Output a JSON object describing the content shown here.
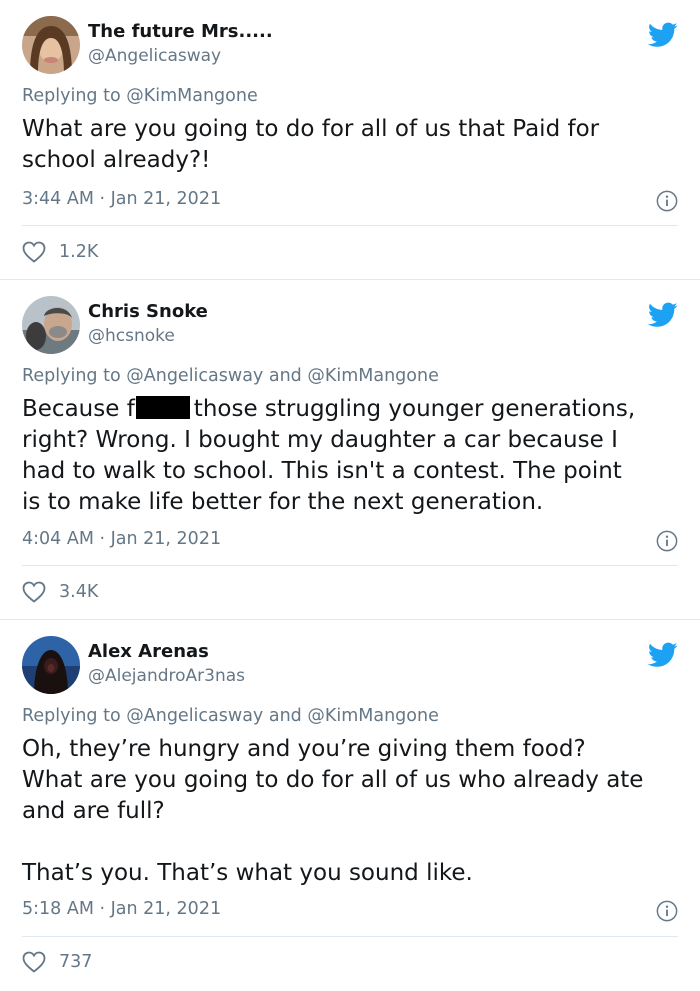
{
  "tweets": [
    {
      "display_name": "The future Mrs.....",
      "handle": "@Angelicasway",
      "replying_prefix": "Replying to",
      "replying_to": [
        "@KimMangone"
      ],
      "text_lines": [
        "What are you going to do for all of us that Paid for",
        "school already?!"
      ],
      "timestamp": "3:44 AM · Jan 21, 2021",
      "likes": "1.2K",
      "avatar_icon": "avatar-photo-woman",
      "brand_icon": "twitter-bird-icon"
    },
    {
      "display_name": "Chris Snoke",
      "handle": "@hcsnoke",
      "replying_prefix": "Replying to",
      "replying_to": [
        "@Angelicasway",
        "@KimMangone"
      ],
      "replying_joiner": "and",
      "text_first_part": "Because f",
      "text_first_rest": "those struggling younger generations,",
      "text_lines": [
        "right? Wrong. I bought my daughter a car because I",
        "had to walk to school. This isn't a contest. The point",
        "is to make life better for the next generation."
      ],
      "timestamp": "4:04 AM · Jan 21, 2021",
      "likes": "3.4K",
      "avatar_icon": "avatar-photo-man",
      "brand_icon": "twitter-bird-icon"
    },
    {
      "display_name": "Alex Arenas",
      "handle": "@AlejandroAr3nas",
      "replying_prefix": "Replying to",
      "replying_to": [
        "@Angelicasway",
        "@KimMangone"
      ],
      "replying_joiner": "and",
      "paragraph_1": [
        "Oh, they’re hungry and you’re giving them food?",
        "What are you going to do for all of us who already ate",
        "and are full?"
      ],
      "paragraph_2": [
        "That’s you. That’s what you sound like."
      ],
      "timestamp": "5:18 AM · Jan 21, 2021",
      "likes": "737",
      "avatar_icon": "avatar-photo-hooded",
      "brand_icon": "twitter-bird-icon"
    }
  ],
  "colors": {
    "brand": "#1da1f2",
    "text": "#14171a",
    "muted": "#657786",
    "divider": "#e1e8ed"
  }
}
